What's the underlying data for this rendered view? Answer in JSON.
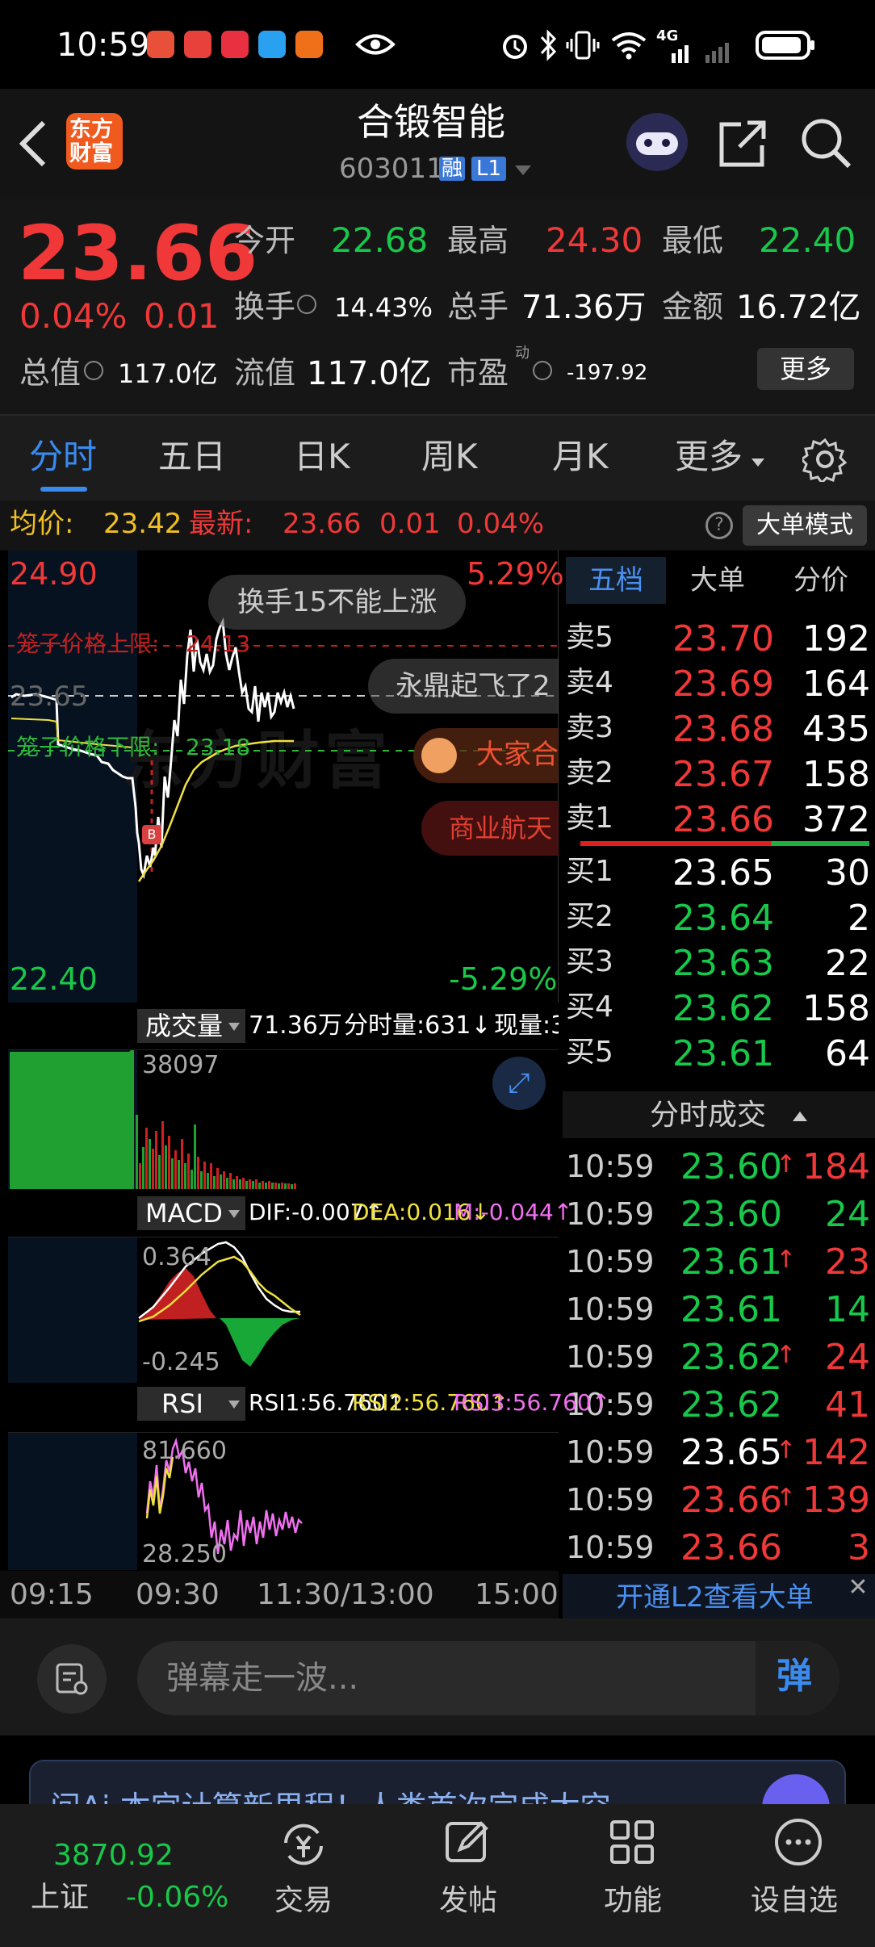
{
  "status": {
    "time": "10:59",
    "net": "4G"
  },
  "header": {
    "logo_line1": "东方",
    "logo_line2": "财富",
    "title": "合锻智能",
    "code": "603011",
    "badge_rong": "融",
    "badge_l1": "L1"
  },
  "quote": {
    "price": "23.66",
    "pct": "0.04%",
    "chg": "0.01",
    "open_label": "今开",
    "open": "22.68",
    "high_label": "最高",
    "high": "24.30",
    "low_label": "最低",
    "low": "22.40",
    "turnover_label": "换手",
    "turnover": "14.43%",
    "vol_label": "总手",
    "vol": "71.36万",
    "amt_label": "金额",
    "amt": "16.72亿",
    "mcap_label": "总值",
    "mcap": "117.0亿",
    "float_label": "流值",
    "float": "117.0亿",
    "pe_label": "市盈",
    "pe_sup": "动",
    "pe": "-197.92",
    "more": "更多"
  },
  "tabs": [
    "分时",
    "五日",
    "日K",
    "周K",
    "月K",
    "更多"
  ],
  "infobar": {
    "avg_label": "均价:",
    "avg": "23.42",
    "latest_label": "最新:",
    "latest": "23.66",
    "chg": "0.01",
    "pct": "0.04%",
    "mode_button": "大单模式"
  },
  "chart": {
    "y_top": "24.90",
    "y_bottom": "22.40",
    "pct_top": "5.29%",
    "pct_bottom": "-5.29%",
    "ref": "23.65",
    "cage_upper_label": "笼子价格上限:",
    "cage_upper": "24.13",
    "cage_lower_label": "笼子价格下限:",
    "cage_lower": "23.18",
    "watermark": "东方财富",
    "danmu": [
      "换手15不能上涨",
      "永鼎起飞了2",
      "大家合",
      "商业航天"
    ],
    "vol_select": "成交量",
    "vol_total": "71.36万",
    "vol_tick": "分时量:631↓",
    "vol_now": "现量:3",
    "vol_max": "38097",
    "macd_select": "MACD",
    "dif": "DIF:-0.007↑",
    "dea": "DEA:0.016↓",
    "m": "M:-0.044↑",
    "macd_top": "0.364",
    "macd_bottom": "-0.245",
    "rsi_select": "RSI",
    "rsi1": "RSI1:56.760↑",
    "rsi2": "RSI2:56.760↑",
    "rsi3": "RSI3:56.760↑",
    "rsi_top": "81.660",
    "rsi_bottom": "28.250",
    "times": [
      "09:15",
      "09:30",
      "11:30/13:00",
      "15:00"
    ]
  },
  "orderbook": {
    "tabs": [
      "五档",
      "大单",
      "分价"
    ],
    "sells": [
      {
        "label": "卖5",
        "price": "23.70",
        "vol": "192"
      },
      {
        "label": "卖4",
        "price": "23.69",
        "vol": "164"
      },
      {
        "label": "卖3",
        "price": "23.68",
        "vol": "435"
      },
      {
        "label": "卖2",
        "price": "23.67",
        "vol": "158"
      },
      {
        "label": "卖1",
        "price": "23.66",
        "vol": "372"
      }
    ],
    "buys": [
      {
        "label": "买1",
        "price": "23.65",
        "vol": "30"
      },
      {
        "label": "买2",
        "price": "23.64",
        "vol": "2"
      },
      {
        "label": "买3",
        "price": "23.63",
        "vol": "22"
      },
      {
        "label": "买4",
        "price": "23.62",
        "vol": "158"
      },
      {
        "label": "买5",
        "price": "23.61",
        "vol": "64"
      }
    ],
    "ticks_title": "分时成交",
    "ticks": [
      {
        "time": "10:59",
        "price": "23.60",
        "arrow": "↑",
        "vol": "184",
        "pc": "green",
        "vc": "red"
      },
      {
        "time": "10:59",
        "price": "23.60",
        "arrow": "",
        "vol": "24",
        "pc": "green",
        "vc": "green"
      },
      {
        "time": "10:59",
        "price": "23.61",
        "arrow": "↑",
        "vol": "23",
        "pc": "green",
        "vc": "red"
      },
      {
        "time": "10:59",
        "price": "23.61",
        "arrow": "",
        "vol": "14",
        "pc": "green",
        "vc": "green"
      },
      {
        "time": "10:59",
        "price": "23.62",
        "arrow": "↑",
        "vol": "24",
        "pc": "green",
        "vc": "red"
      },
      {
        "time": "10:59",
        "price": "23.62",
        "arrow": "",
        "vol": "41",
        "pc": "green",
        "vc": "red"
      },
      {
        "time": "10:59",
        "price": "23.65",
        "arrow": "↑",
        "vol": "142",
        "pc": "white",
        "vc": "red"
      },
      {
        "time": "10:59",
        "price": "23.66",
        "arrow": "↑",
        "vol": "139",
        "pc": "red",
        "vc": "red"
      },
      {
        "time": "10:59",
        "price": "23.66",
        "arrow": "",
        "vol": "3",
        "pc": "red",
        "vc": "red"
      }
    ],
    "l2_link": "开通L2查看大单"
  },
  "danmu_input": {
    "placeholder": "弹幕走一波...",
    "send": "弹"
  },
  "ad": {
    "text": "问Ai  本宫计算新里程！人类首次完成太空"
  },
  "bottom": {
    "index_value": "3870.92",
    "index_name": "上证",
    "index_pct": "-0.06%",
    "items": [
      "交易",
      "发帖",
      "功能",
      "设自选"
    ]
  }
}
